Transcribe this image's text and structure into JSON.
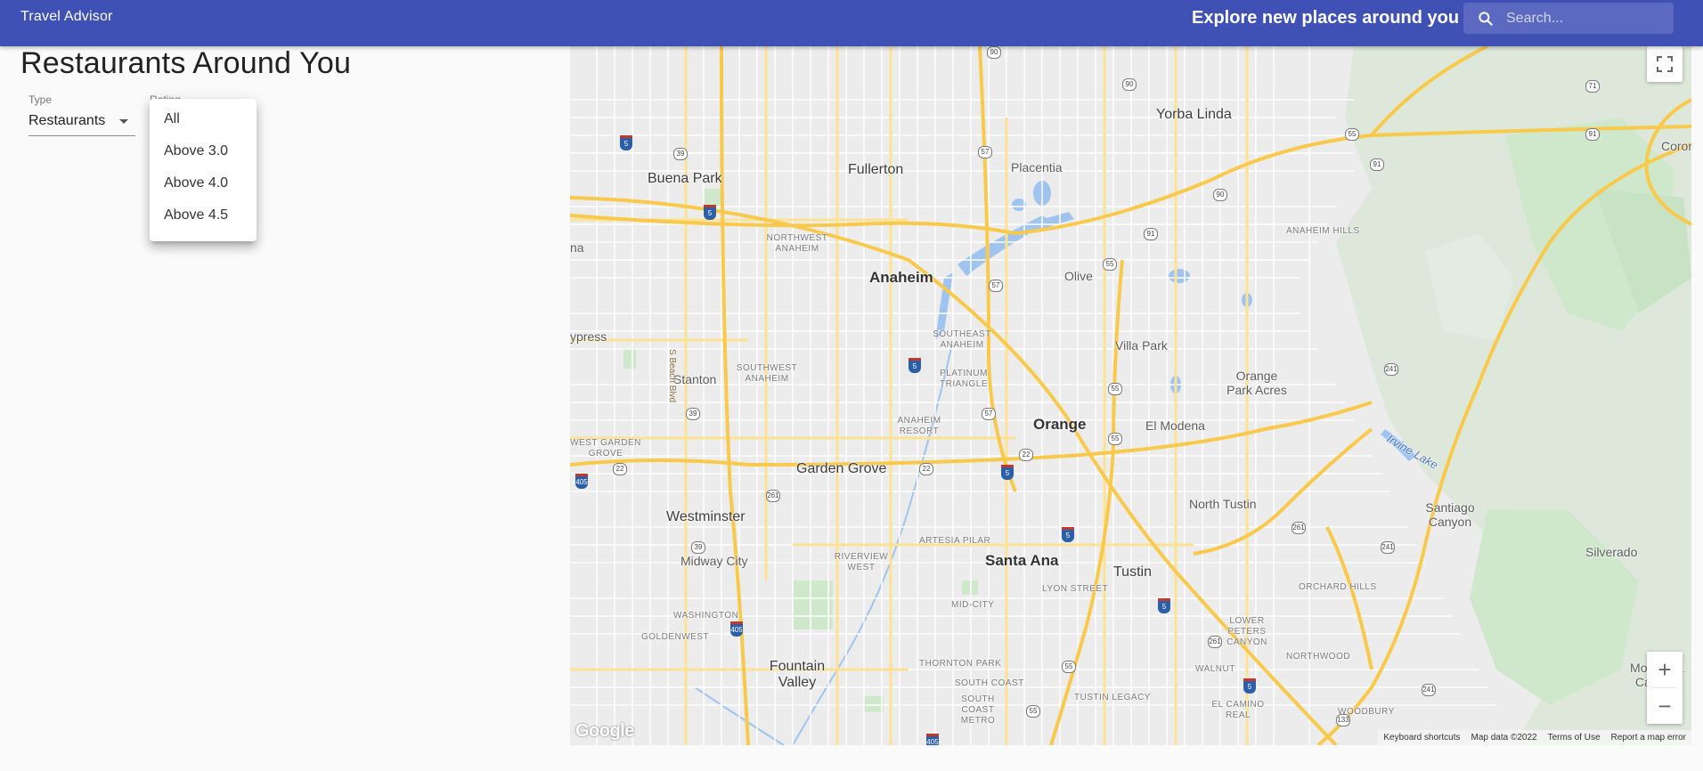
{
  "appbar": {
    "title": "Travel Advisor",
    "tagline": "Explore new places around you",
    "search_placeholder": "Search...",
    "search_icon": "search-icon"
  },
  "main": {
    "title": "Restaurants Around You",
    "type_label": "Type",
    "type_value": "Restaurants",
    "rating_label": "Rating",
    "rating_options": [
      "All",
      "Above 3.0",
      "Above 4.0",
      "Above 4.5"
    ]
  },
  "map": {
    "cities": [
      "Yorba Linda",
      "Fullerton",
      "Placentia",
      "Buena Park",
      "Anaheim",
      "Olive",
      "Villa Park",
      "Orange Park Acres",
      "Stanton",
      "Orange",
      "El Modena",
      "Garden Grove",
      "Westminster",
      "North Tustin",
      "Santiago Canyon",
      "Midway City",
      "Santa Ana",
      "Tustin",
      "Silverado",
      "Fountain Valley",
      "Modjeska Canyon",
      "ypress",
      "na",
      "Coron"
    ],
    "neighborhoods": [
      "NORTHWEST ANAHEIM",
      "SOUTHEAST ANAHEIM",
      "SOUTHWEST ANAHEIM",
      "PLATINUM TRIANGLE",
      "ANAHEIM RESORT",
      "ANAHEIM HILLS",
      "WEST GARDEN GROVE",
      "ARTESIA PILAR",
      "RIVERVIEW WEST",
      "LYON STREET",
      "ORCHARD HILLS",
      "MID-CITY",
      "WASHINGTON",
      "GOLDENWEST",
      "LOWER PETERS CANYON",
      "NORTHWOOD",
      "WALNUT",
      "THORNTON PARK",
      "SOUTH COAST",
      "SOUTH COAST METRO",
      "TUSTIN LEGACY",
      "EL CAMINO REAL",
      "WOODBURY"
    ],
    "water": [
      "Irvine Lake"
    ],
    "road_label": "S Beach Blvd",
    "highway_shields": [
      "90",
      "71",
      "91",
      "39",
      "57",
      "90",
      "91",
      "91",
      "55",
      "57",
      "241",
      "55",
      "39",
      "57",
      "22",
      "55",
      "405",
      "22",
      "22",
      "261",
      "39",
      "261",
      "241",
      "55",
      "261",
      "241",
      "55",
      "133",
      "405",
      "55",
      "90"
    ],
    "interstate_shields": [
      "5",
      "5",
      "5",
      "5",
      "5",
      "5",
      "5",
      "405",
      "405",
      "405"
    ],
    "google_logo": "Google",
    "attribution": [
      "Keyboard shortcuts",
      "Map data ©2022",
      "Terms of Use",
      "Report a map error"
    ],
    "zoom_in": "+",
    "zoom_out": "−",
    "fullscreen_icon": "fullscreen-icon"
  }
}
